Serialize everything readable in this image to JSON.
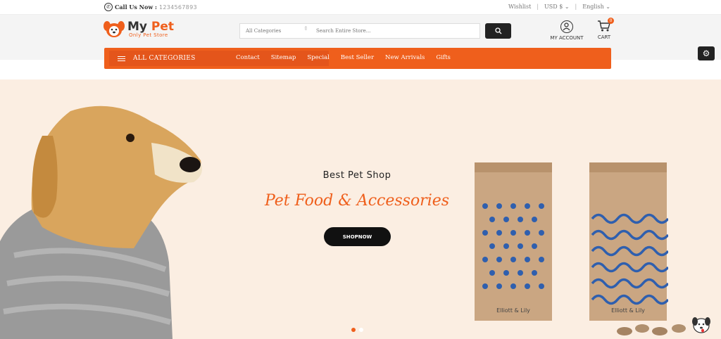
{
  "topbar": {
    "call_label": "Call Us Now :",
    "phone_number": "1234567893",
    "wishlist": "Wishlist",
    "currency": "USD $",
    "language": "English"
  },
  "logo": {
    "name_part1": "My",
    "name_part2": "Pet",
    "tagline": "Only Pet Store"
  },
  "search": {
    "category_selected": "All Categories",
    "placeholder": "Search Entire Store..."
  },
  "account": {
    "label": "MY ACCOUNT"
  },
  "cart": {
    "label": "CART",
    "count": "0"
  },
  "nav": {
    "all_categories": "ALL CATEGORIES",
    "links": [
      "Contact",
      "Sitemap",
      "Special",
      "Best Seller",
      "New Arrivals",
      "Gifts"
    ]
  },
  "hero": {
    "heading": "Best Pet Shop",
    "subheading": "Pet Food & Accessories",
    "button": "SHOPNOW",
    "bag_brand_1": "Elliott & Lily",
    "bag_brand_2": "Elliott & Lily"
  },
  "colors": {
    "accent": "#ef5f1c",
    "hero_bg": "#fbeee2",
    "dark": "#222222"
  }
}
